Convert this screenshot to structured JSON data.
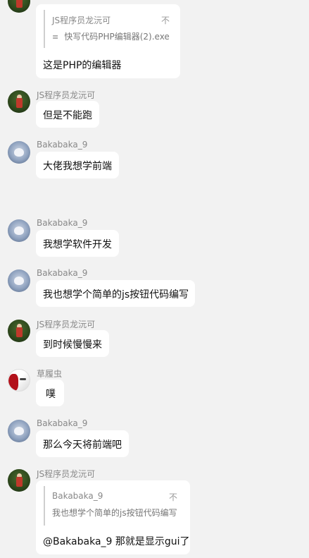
{
  "messages": [
    {
      "sender": "",
      "quote": {
        "sender": "JS程序员龙沅可",
        "close": "不",
        "file_icon": "file-icon",
        "file_name": "快写代码PHP编辑器(2).exe"
      },
      "text": "这是PHP的编辑器"
    },
    {
      "sender": "JS程序员龙沅可",
      "text": "但是不能跑"
    },
    {
      "sender": "Bakabaka_9",
      "text": "大佬我想学前端"
    },
    {
      "sender": "Bakabaka_9",
      "text": "我想学软件开发"
    },
    {
      "sender": "Bakabaka_9",
      "text": "我也想学个简单的js按钮代码编写"
    },
    {
      "sender": "JS程序员龙沅可",
      "text": "到时候慢慢来"
    },
    {
      "sender": "草履虫",
      "text": "噗"
    },
    {
      "sender": "Bakabaka_9",
      "text": "那么今天将前端吧"
    },
    {
      "sender": "JS程序员龙沅可",
      "quote": {
        "sender": "Bakabaka_9",
        "close": "不",
        "text": "我也想学个简单的js按钮代码编写"
      },
      "text": "@Bakabaka_9 那就是显示gui了"
    }
  ]
}
